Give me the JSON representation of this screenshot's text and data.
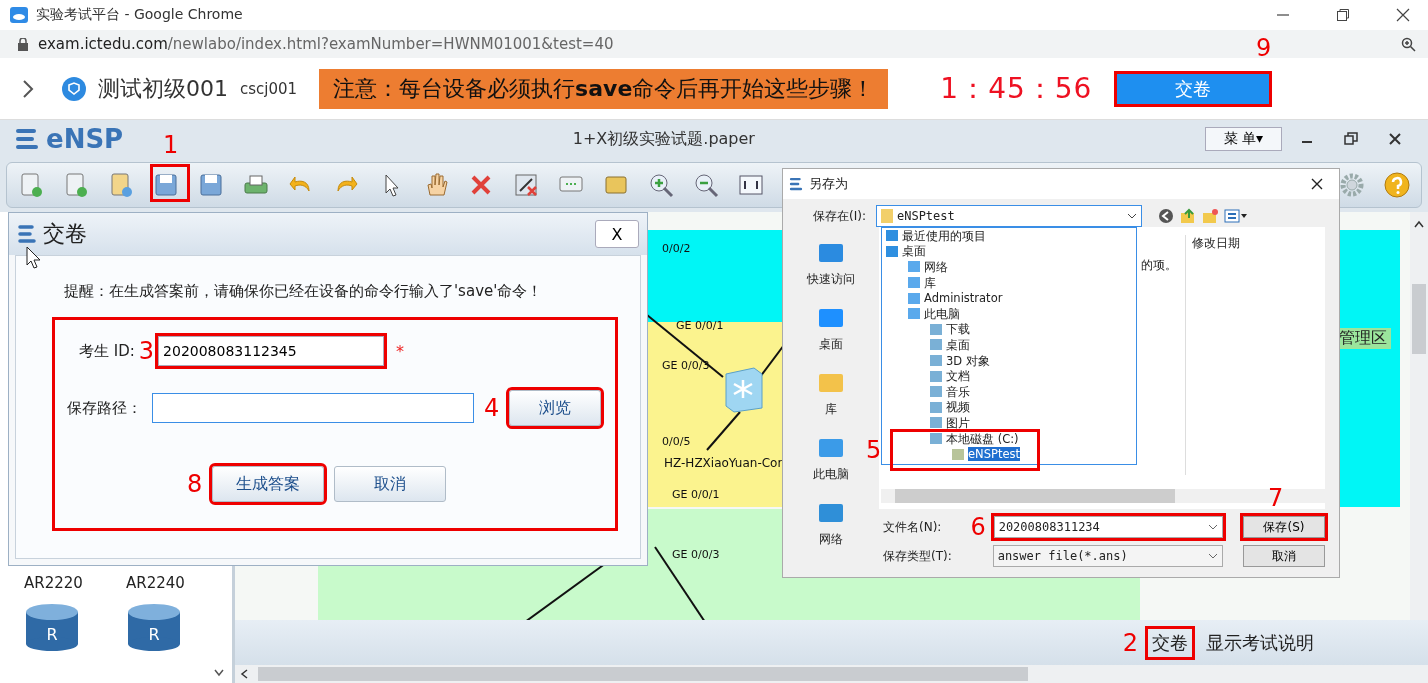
{
  "browser": {
    "title": "实验考试平台 - Google Chrome",
    "url_domain": "exam.ictedu.com",
    "url_path": "/newlabo/index.html?examNumber=HWNM01001&test=40"
  },
  "exam_header": {
    "exam_name": "测试初级001",
    "user": "cscj001",
    "notice": "注意：每台设备必须执行**save**命令后再开始这些步骤！",
    "timer": "1：45：56",
    "submit_button": "交卷"
  },
  "ensp": {
    "logo": "eNSP",
    "file_title": "1+X初级实验试题.paper",
    "menu_button": "菜 单▾"
  },
  "device_panel": {
    "devices": [
      {
        "name": "AR2220"
      },
      {
        "name": "AR2240"
      }
    ],
    "router_icons": [
      {
        "letter": "R"
      },
      {
        "letter": "R"
      }
    ]
  },
  "topology": {
    "port_labels": [
      {
        "text": "0/0/2"
      },
      {
        "text": "GE 0/0/1"
      },
      {
        "text": "GE 0/0/3"
      },
      {
        "text": "0/0/5"
      },
      {
        "text": "GE 0/0/1"
      },
      {
        "text": "GE 0/0/3"
      }
    ],
    "device_label": "HZ-HZXiaoYuan-Cor",
    "zone_label": "管理区"
  },
  "bottom_bar": {
    "submit_link": "交卷",
    "instructions_link": "显示考试说明"
  },
  "submit_dialog": {
    "title": "交卷",
    "close_button": "X",
    "reminder": "提醒：在生成答案前，请确保你已经在设备的命令行输入了'save'命令！",
    "student_id_label": "考生 ID:",
    "student_id": "202008083112345",
    "required_mark": "*",
    "path_label": "保存路径：",
    "browse_button": "浏览",
    "generate_button": "生成答案",
    "cancel_button": "取消"
  },
  "save_dialog": {
    "title": "另存为",
    "save_in_label": "保存在(I):",
    "save_in_value": "eNSPtest",
    "places": [
      "快速访问",
      "桌面",
      "库",
      "此电脑",
      "网络"
    ],
    "column_header": "修改日期",
    "list_text": "的项。",
    "folder_tree": [
      {
        "label": "最近使用的项目",
        "selected": false
      },
      {
        "label": "桌面",
        "selected": false,
        "children": [
          {
            "label": "网络",
            "selected": false
          },
          {
            "label": "库",
            "selected": false
          },
          {
            "label": "Administrator",
            "selected": false
          },
          {
            "label": "此电脑",
            "selected": false,
            "children": [
              {
                "label": "下载",
                "selected": false
              },
              {
                "label": "桌面",
                "selected": false
              },
              {
                "label": "3D 对象",
                "selected": false
              },
              {
                "label": "文档",
                "selected": false
              },
              {
                "label": "音乐",
                "selected": false
              },
              {
                "label": "视频",
                "selected": false
              },
              {
                "label": "图片",
                "selected": false
              },
              {
                "label": "本地磁盘 (C:)",
                "selected": false,
                "children": [
                  {
                    "label": "eNSPtest",
                    "selected": true
                  }
                ]
              }
            ]
          }
        ]
      }
    ],
    "filename_label": "文件名(N):",
    "filename": "20200808311234",
    "filetype_label": "保存类型(T):",
    "filetype": "answer file(*.ans)",
    "save_button": "保存(S)",
    "cancel_button": "取消"
  },
  "annotations": [
    "1",
    "2",
    "3",
    "4",
    "5",
    "6",
    "7",
    "8",
    "9"
  ]
}
